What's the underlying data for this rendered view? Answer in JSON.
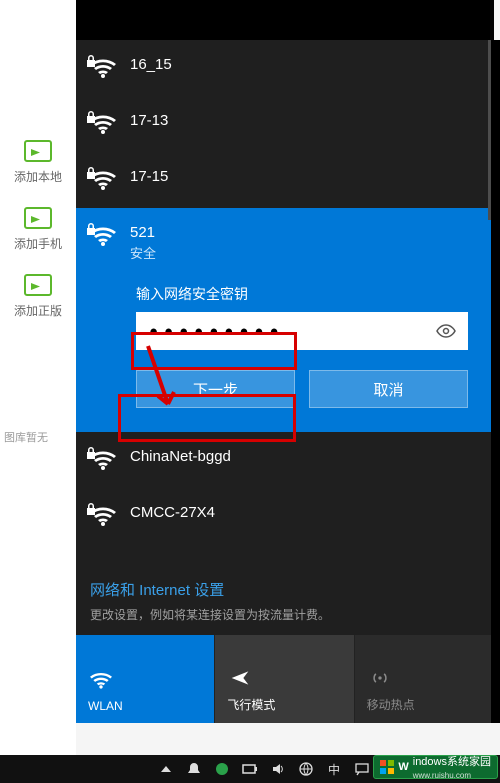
{
  "sidebar": {
    "items": [
      {
        "label": "添加本地"
      },
      {
        "label": "添加手机"
      },
      {
        "label": "添加正版"
      }
    ],
    "empty_hint": "图库暂无"
  },
  "networks": {
    "list": [
      {
        "name": "16_15"
      },
      {
        "name": "17-13"
      },
      {
        "name": "17-15"
      }
    ],
    "active": {
      "name": "521",
      "sub": "安全",
      "pwd_label": "输入网络安全密钥",
      "pwd_value": "●●●●●●●●●",
      "next": "下一步",
      "cancel": "取消"
    },
    "below": [
      {
        "name": "ChinaNet-bggd"
      },
      {
        "name": "CMCC-27X4"
      }
    ]
  },
  "settings": {
    "title": "网络和 Internet 设置",
    "sub": "更改设置，例如将某连接设置为按流量计费。"
  },
  "tiles": {
    "wlan": "WLAN",
    "airplane": "飞行模式",
    "hotspot": "移动热点"
  },
  "taskbar": {
    "ime": "中"
  },
  "badge": {
    "text": "indows系统家园",
    "sub": "www.ruishu.com"
  }
}
